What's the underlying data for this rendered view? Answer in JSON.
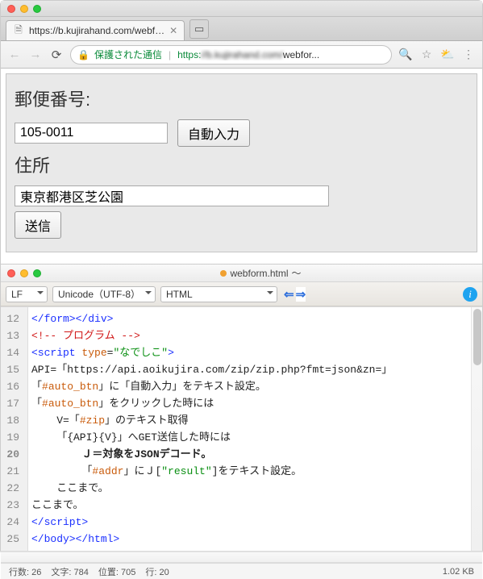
{
  "browser": {
    "tab_title": "https://b.kujirahand.com/webf…",
    "secure_label": "保護された通信",
    "url_https": "https:",
    "url_host": "//b.kujirahand.com/",
    "url_path": "webfor..."
  },
  "form": {
    "zip_label": "郵便番号:",
    "zip_value": "105-0011",
    "auto_btn": "自動入力",
    "addr_label": "住所",
    "addr_value": "東京都港区芝公園",
    "submit": "送信"
  },
  "editor": {
    "title": "webform.html",
    "title_suffix": "〜",
    "encoding_sel": "LF",
    "charset_sel": "Unicode（UTF-8）",
    "lang_sel": "HTML",
    "info_icon": "i",
    "code_lines": [
      {
        "n": "12",
        "html": "<span class='t-tag'>&lt;/form&gt;&lt;/div&gt;</span>"
      },
      {
        "n": "13",
        "html": "<span class='t-comm'>&lt;!-- プログラム --&gt;</span>"
      },
      {
        "n": "14",
        "html": "<span class='t-tag'>&lt;script </span><span class='t-attr'>type</span>=<span class='t-str'>\"なでしこ\"</span><span class='t-tag'>&gt;</span>"
      },
      {
        "n": "15",
        "html": "API=「https://api.aoikujira.com/zip/zip.php?fmt=json&amp;zn=」"
      },
      {
        "n": "16",
        "html": "「<span class='t-sel'>#auto_btn</span>」に「自動入力」をテキスト設定。"
      },
      {
        "n": "17",
        "html": "「<span class='t-sel'>#auto_btn</span>」をクリックした時には"
      },
      {
        "n": "18",
        "html": "    V=「<span class='t-sel'>#zip</span>」のテキスト取得"
      },
      {
        "n": "19",
        "html": "    「{API}{V}」へGET送信した時には"
      },
      {
        "n": "20",
        "html": "        Ｊ＝対象をJSONデコード。"
      },
      {
        "n": "21",
        "html": "        「<span class='t-sel'>#addr</span>」にＪ[<span class='t-str'>\"result\"</span>]をテキスト設定。"
      },
      {
        "n": "22",
        "html": "    ここまで。"
      },
      {
        "n": "23",
        "html": "ここまで。"
      },
      {
        "n": "24",
        "html": "<span class='t-tag'>&lt;/script&gt;</span>"
      },
      {
        "n": "25",
        "html": "<span class='t-tag'>&lt;/body&gt;&lt;/html&gt;</span>"
      }
    ],
    "status": {
      "lines_label": "行数:",
      "lines": "26",
      "chars_label": "文字:",
      "chars": "784",
      "pos_label": "位置:",
      "pos": "705",
      "row_label": "行:",
      "row": "20",
      "size": "1.02 KB"
    }
  }
}
